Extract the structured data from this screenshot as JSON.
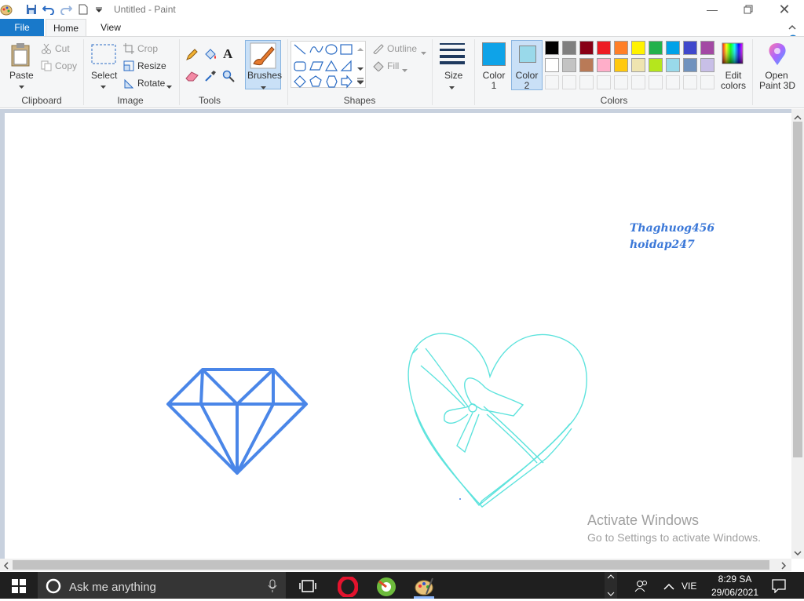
{
  "window": {
    "title": "Untitled - Paint"
  },
  "tabs": {
    "file": "File",
    "home": "Home",
    "view": "View"
  },
  "clipboard": {
    "paste": "Paste",
    "cut": "Cut",
    "copy": "Copy",
    "group": "Clipboard"
  },
  "image": {
    "select": "Select",
    "crop": "Crop",
    "resize": "Resize",
    "rotate": "Rotate",
    "group": "Image"
  },
  "tools": {
    "group": "Tools"
  },
  "brushes": {
    "label": "Brushes"
  },
  "shapes": {
    "outline": "Outline",
    "fill": "Fill",
    "group": "Shapes"
  },
  "size": {
    "label": "Size"
  },
  "colors": {
    "color1_label": "Color",
    "color1_num": "1",
    "color2_label": "Color",
    "color2_num": "2",
    "color1_value": "#0ea3e8",
    "color2_value": "#99d9ea",
    "edit_line1": "Edit",
    "edit_line2": "colors",
    "group": "Colors",
    "palette_row1": [
      "#000000",
      "#7f7f7f",
      "#880015",
      "#ed1c24",
      "#ff7f27",
      "#fff200",
      "#22b14c",
      "#00a2e8",
      "#3f48cc",
      "#a349a4"
    ],
    "palette_row2": [
      "#ffffff",
      "#c3c3c3",
      "#b97a57",
      "#ffaec9",
      "#ffc90e",
      "#efe4b0",
      "#b5e61d",
      "#99d9ea",
      "#7092be",
      "#c8bfe7"
    ]
  },
  "paint3d": {
    "line1": "Open",
    "line2": "Paint 3D"
  },
  "canvas": {
    "text_line1": "Thaghuog456",
    "text_line2": "hoidap247",
    "diamond_color": "#4a86e8",
    "heart_color": "#5ee3dd"
  },
  "watermark": {
    "line1": "Activate Windows",
    "line2": "Go to Settings to activate Windows."
  },
  "taskbar": {
    "search_placeholder": "Ask me anything",
    "lang": "VIE",
    "time": "8:29 SA",
    "date": "29/06/2021"
  }
}
